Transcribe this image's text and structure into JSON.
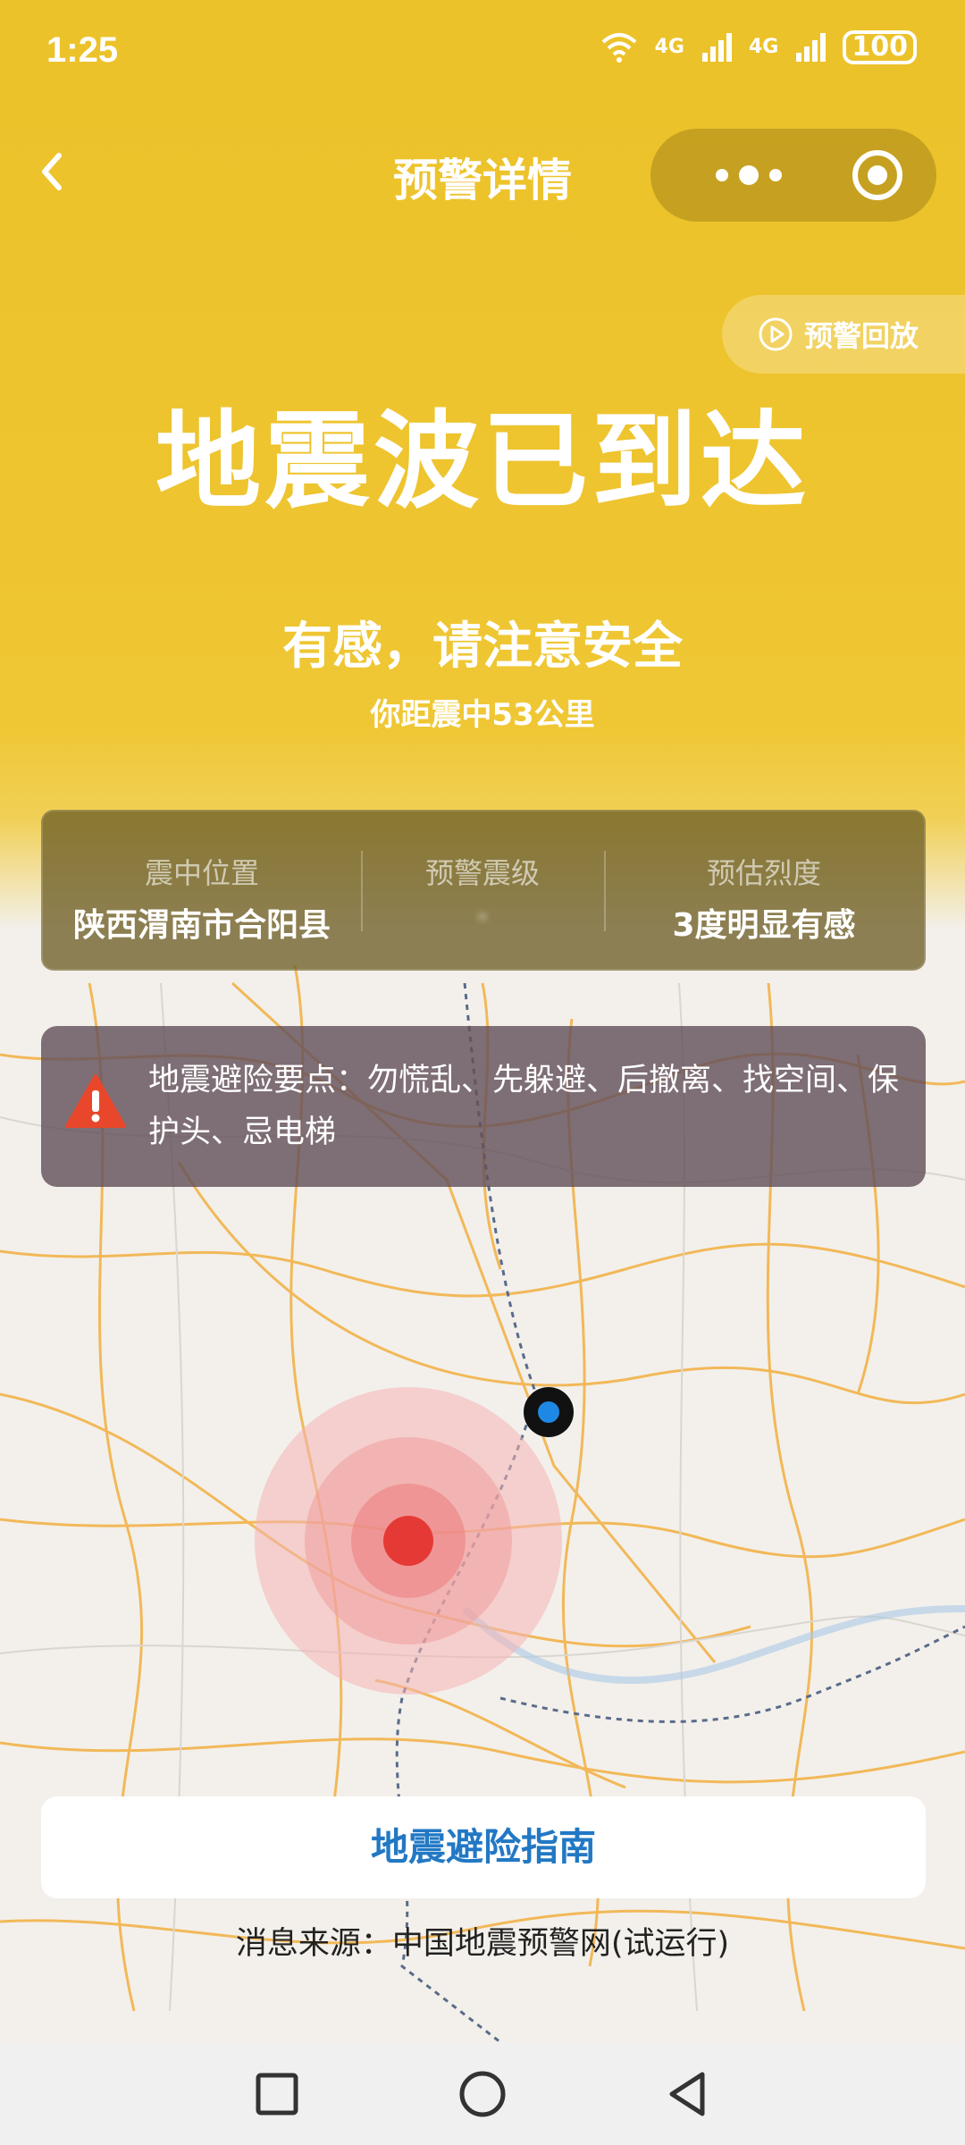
{
  "status_bar": {
    "time": "1:25",
    "signal_1": "4G",
    "signal_2": "4G",
    "battery": "100"
  },
  "nav": {
    "title": "预警详情"
  },
  "replay": {
    "label": "预警回放"
  },
  "alert": {
    "headline": "地震波已到达",
    "subtitle": "有感，请注意安全",
    "distance": "你距震中53公里"
  },
  "info": {
    "location_label": "震中位置",
    "location_value": "陕西渭南市合阳县",
    "magnitude_label": "预警震级",
    "magnitude_value": "·",
    "intensity_label": "预估烈度",
    "intensity_value": "3度明显有感"
  },
  "tip": {
    "text": "地震避险要点：勿慌乱、先躲避、后撤离、找空间、保护头、忌电梯"
  },
  "guide_button": {
    "label": "地震避险指南"
  },
  "source": {
    "text": "消息来源：中国地震预警网(试运行)"
  },
  "colors": {
    "hero_yellow": "#ecc22a",
    "epicenter_red": "#e53935",
    "user_blue": "#1e88e5",
    "guide_text_blue": "#2278c4",
    "warning_red": "#e8472b"
  }
}
